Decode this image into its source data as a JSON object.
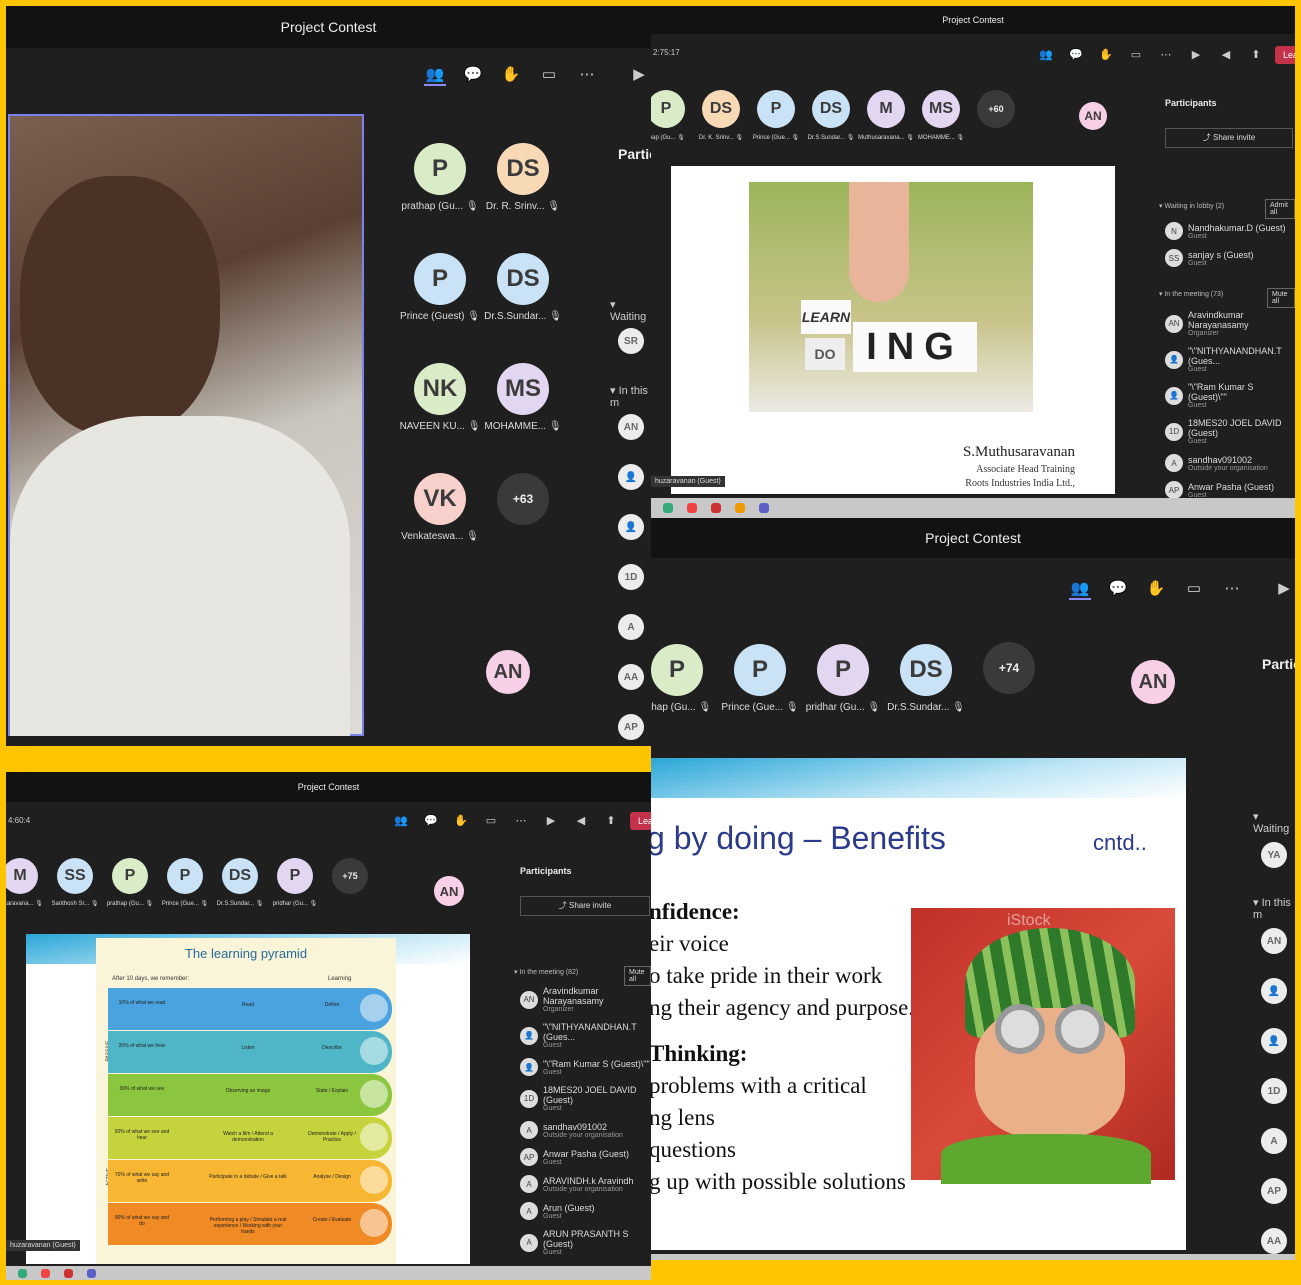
{
  "title": "Project Contest",
  "p1": {
    "avatars": [
      {
        "i": "P",
        "n": "prathap (Gu...",
        "c": "#d9ecc7"
      },
      {
        "i": "DS",
        "n": "Dr. R. Srinv...",
        "c": "#f7d9b5"
      },
      {
        "i": "P",
        "n": "Prince (Guest)",
        "c": "#c9e2f5"
      },
      {
        "i": "DS",
        "n": "Dr.S.Sundar...",
        "c": "#c9e2f5"
      },
      {
        "i": "NK",
        "n": "NAVEEN KU...",
        "c": "#d9ecc7"
      },
      {
        "i": "MS",
        "n": "MOHAMME...",
        "c": "#e3d6f0"
      },
      {
        "i": "VK",
        "n": "Venkateswa...",
        "c": "#f7d0cb"
      }
    ],
    "more": "+63",
    "me": "AN",
    "partic": "Partic",
    "waiting": "Waiting",
    "inthis": "In this m",
    "side": [
      "SR",
      "AN",
      "",
      "",
      "1D",
      "A",
      "AA",
      "AP"
    ]
  },
  "p2": {
    "time": "2:75:17",
    "avatars": [
      {
        "i": "P",
        "n": "thap (Gu...",
        "c": "#d9ecc7"
      },
      {
        "i": "DS",
        "n": "Dr. K. Srinv...",
        "c": "#f7d9b5"
      },
      {
        "i": "P",
        "n": "Prince (Gue...",
        "c": "#c9e2f5"
      },
      {
        "i": "DS",
        "n": "Dr.S.Sundar...",
        "c": "#c9e2f5"
      },
      {
        "i": "M",
        "n": "Muthusaravana...",
        "c": "#e3d6f0"
      },
      {
        "i": "MS",
        "n": "MOHAMME...",
        "c": "#e3d6f0"
      }
    ],
    "more": "+60",
    "me": "AN",
    "leave": "Leave",
    "participants": "Participants",
    "share": "Share invite",
    "lobby": "Waiting in lobby (2)",
    "admit": "Admit all",
    "lobby_list": [
      {
        "n": "Nandhakumar.D (Guest)",
        "s": "Guest",
        "i": "N"
      },
      {
        "n": "sanjay s (Guest)",
        "s": "Guest",
        "i": "SS"
      }
    ],
    "meeting": "In the meeting (73)",
    "muteall": "Mute all",
    "list": [
      {
        "n": "Aravindkumar Narayanasamy",
        "s": "Organizer",
        "i": "AN"
      },
      {
        "n": "\"\\\"NITHYANANDHAN.T (Gues...",
        "s": "Guest",
        "i": ""
      },
      {
        "n": "\"\\\"Ram Kumar S (Guest)\\\"\"",
        "s": "Guest",
        "i": ""
      },
      {
        "n": "18MES20 JOEL DAVID (Guest)",
        "s": "Guest",
        "i": "1D"
      },
      {
        "n": "sandhav091002",
        "s": "Outside your organisation",
        "i": "A"
      },
      {
        "n": "Anwar Pasha (Guest)",
        "s": "Guest",
        "i": "AP"
      }
    ],
    "slide_learn": "LEARN",
    "slide_do": "DO",
    "slide_ing": "ING",
    "presenter": "S.Muthusaravanan",
    "role": "Associate Head Training",
    "company": "Roots Industries India Ltd.,",
    "tag": "huzaravanan (Guest)"
  },
  "p3": {
    "avatars": [
      {
        "i": "P",
        "n": "athap (Gu...",
        "c": "#d9ecc7"
      },
      {
        "i": "P",
        "n": "Prince (Gue...",
        "c": "#c9e2f5"
      },
      {
        "i": "P",
        "n": "pridhar (Gu...",
        "c": "#e3d6f0"
      },
      {
        "i": "DS",
        "n": "Dr.S.Sundar...",
        "c": "#c9e2f5"
      }
    ],
    "more": "+74",
    "me": "AN",
    "partic": "Partic",
    "waiting": "Waiting",
    "inthis": "In this m",
    "side": [
      "YA",
      "AN",
      "",
      "",
      "1D",
      "A",
      "AP",
      "AA"
    ],
    "slide_title": "g by doing – Benefits",
    "cntd": "cntd..",
    "lines": [
      "nfidence:",
      "eir voice",
      "o take pride in their work",
      "ng their agency and purpose.",
      "Thinking:",
      "problems with a critical",
      "ng lens",
      "questions",
      "g up with possible solutions"
    ],
    "wm": "iStock"
  },
  "p4": {
    "time": "4:60:4",
    "avatars": [
      {
        "i": "M",
        "n": "huzaravana...",
        "c": "#e3d6f0"
      },
      {
        "i": "SS",
        "n": "Santhosh Sr...",
        "c": "#c9e2f5"
      },
      {
        "i": "P",
        "n": "prathap (Gu...",
        "c": "#d9ecc7"
      },
      {
        "i": "P",
        "n": "Prince (Gue...",
        "c": "#c9e2f5"
      },
      {
        "i": "DS",
        "n": "Dr.S.Sundar...",
        "c": "#c9e2f5"
      },
      {
        "i": "P",
        "n": "pridhar (Gu...",
        "c": "#e3d6f0"
      }
    ],
    "more": "+75",
    "me": "AN",
    "leave": "Leave",
    "participants": "Participants",
    "share": "Share invite",
    "meeting": "In the meeting (82)",
    "muteall": "Mute all",
    "list": [
      {
        "n": "Aravindkumar Narayanasamy",
        "s": "Organizer",
        "i": "AN"
      },
      {
        "n": "\"\\\"NITHYANANDHAN.T (Gues...",
        "s": "Guest",
        "i": ""
      },
      {
        "n": "\"\\\"Ram Kumar S (Guest)\\\"\"",
        "s": "Guest",
        "i": ""
      },
      {
        "n": "18MES20 JOEL DAVID (Guest)",
        "s": "Guest",
        "i": "1D"
      },
      {
        "n": "sandhav091002",
        "s": "Outside your organisation",
        "i": "A"
      },
      {
        "n": "Anwar Pasha (Guest)",
        "s": "Guest",
        "i": "AP"
      },
      {
        "n": "ARAVINDH.k Aravindh",
        "s": "Outside your organisation",
        "i": "A"
      },
      {
        "n": "Arun (Guest)",
        "s": "Guest",
        "i": "A"
      },
      {
        "n": "ARUN PRASANTH S (Guest)",
        "s": "Guest",
        "i": "A"
      }
    ],
    "pyr_title": "The learning pyramid",
    "pyr_after": "After 10 days, we remember:",
    "pyr_learn": "Learning",
    "passive": "PASSIVE",
    "active": "ACTIVE",
    "rows": [
      {
        "l": "10% of what we read",
        "m": "Read",
        "r": "Define",
        "c": "#4aa3df"
      },
      {
        "l": "20% of what we hear",
        "m": "Listen",
        "r": "Describe",
        "c": "#4fb6c8"
      },
      {
        "l": "30% of what we see",
        "m": "Observing an image",
        "r": "State / Explain",
        "c": "#8cc63f"
      },
      {
        "l": "50% of what we see and hear",
        "m": "Watch a film / Attend a demonstration",
        "r": "Demonstrate / Apply / Practice",
        "c": "#c6d33c"
      },
      {
        "l": "70% of what we say and write",
        "m": "Participate in a debate / Give a talk",
        "r": "Analyse / Design",
        "c": "#f7b733"
      },
      {
        "l": "90% of what we say and do",
        "m": "Performing a play / Simulate a real experience / Working with your hands",
        "r": "Create / Evaluate",
        "c": "#f08a24"
      }
    ],
    "tag": "huzaravanan (Guest)"
  }
}
